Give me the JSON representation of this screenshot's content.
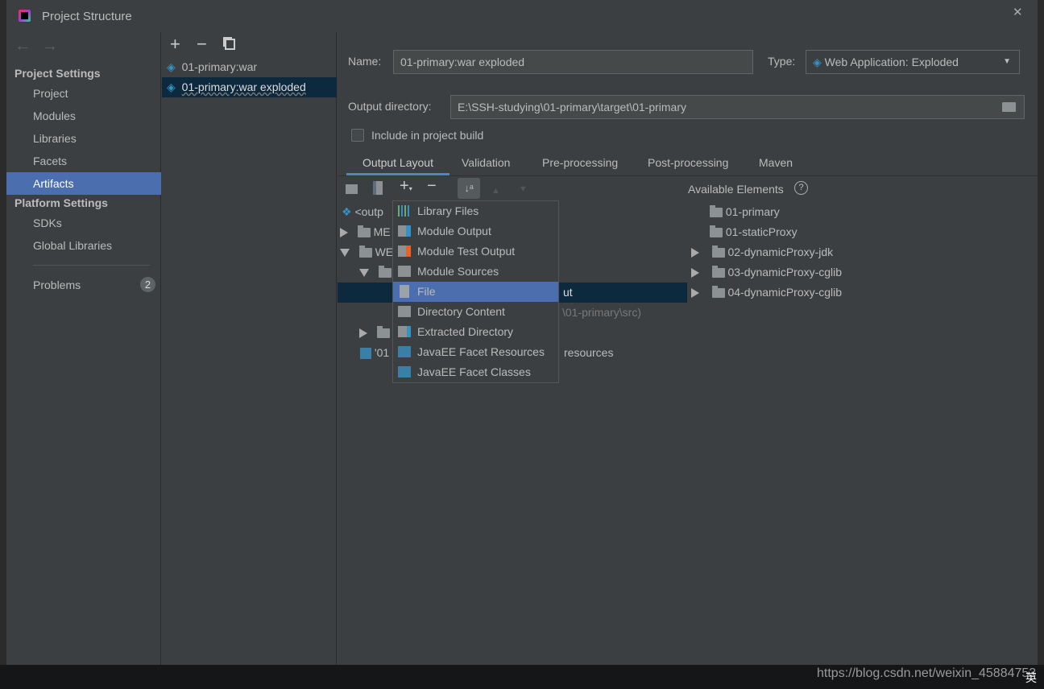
{
  "window": {
    "title": "Project Structure",
    "close": "✕"
  },
  "sidebar": {
    "project_settings": "Project Settings",
    "items": [
      {
        "label": "Project"
      },
      {
        "label": "Modules"
      },
      {
        "label": "Libraries"
      },
      {
        "label": "Facets"
      },
      {
        "label": "Artifacts",
        "selected": true
      }
    ],
    "platform_settings": "Platform Settings",
    "platform_items": [
      {
        "label": "SDKs"
      },
      {
        "label": "Global Libraries"
      }
    ],
    "problems": {
      "label": "Problems",
      "count": "2"
    }
  },
  "artifacts": {
    "toolbar": {
      "add": "+",
      "remove": "−"
    },
    "items": [
      {
        "label": "01-primary:war"
      },
      {
        "label": "01-primary:war exploded",
        "selected": true
      }
    ]
  },
  "form": {
    "name_label": "Name:",
    "name_value": "01-primary:war exploded",
    "type_label": "Type:",
    "type_value": "Web Application: Exploded",
    "output_label": "Output directory:",
    "output_value": "E:\\SSH-studying\\01-primary\\target\\01-primary",
    "include_label": "Include in project build",
    "include_checked": false
  },
  "tabs": [
    {
      "label": "Output Layout",
      "active": true
    },
    {
      "label": "Validation"
    },
    {
      "label": "Pre-processing"
    },
    {
      "label": "Post-processing"
    },
    {
      "label": "Maven"
    }
  ],
  "layout_tree": {
    "rows": [
      "<outp",
      "ME",
      "WE",
      "ut",
      "\\01-primary\\src)",
      "'01",
      "resources"
    ]
  },
  "add_menu": {
    "items": [
      {
        "label": "Library Files"
      },
      {
        "label": "Module Output"
      },
      {
        "label": "Module Test Output"
      },
      {
        "label": "Module Sources"
      },
      {
        "label": "File",
        "selected": true
      },
      {
        "label": "Directory Content"
      },
      {
        "label": "Extracted Directory"
      },
      {
        "label": "JavaEE Facet Resources"
      },
      {
        "label": "JavaEE Facet Classes"
      }
    ]
  },
  "available": {
    "title": "Available Elements",
    "help": "?",
    "items": [
      {
        "label": "01-primary"
      },
      {
        "label": "01-staticProxy"
      },
      {
        "label": "02-dynamicProxy-jdk",
        "expandable": true
      },
      {
        "label": "03-dynamicProxy-cglib",
        "expandable": true
      },
      {
        "label": "04-dynamicProxy-cglib",
        "expandable": true
      }
    ]
  },
  "watermark": "https://blog.csdn.net/weixin_45884753",
  "taskbar": {
    "ime": "英"
  },
  "colors": {
    "selection": "#4b6eaf",
    "list_selection": "#0d293e",
    "background": "#3c3f41",
    "accent": "#3592c4"
  }
}
